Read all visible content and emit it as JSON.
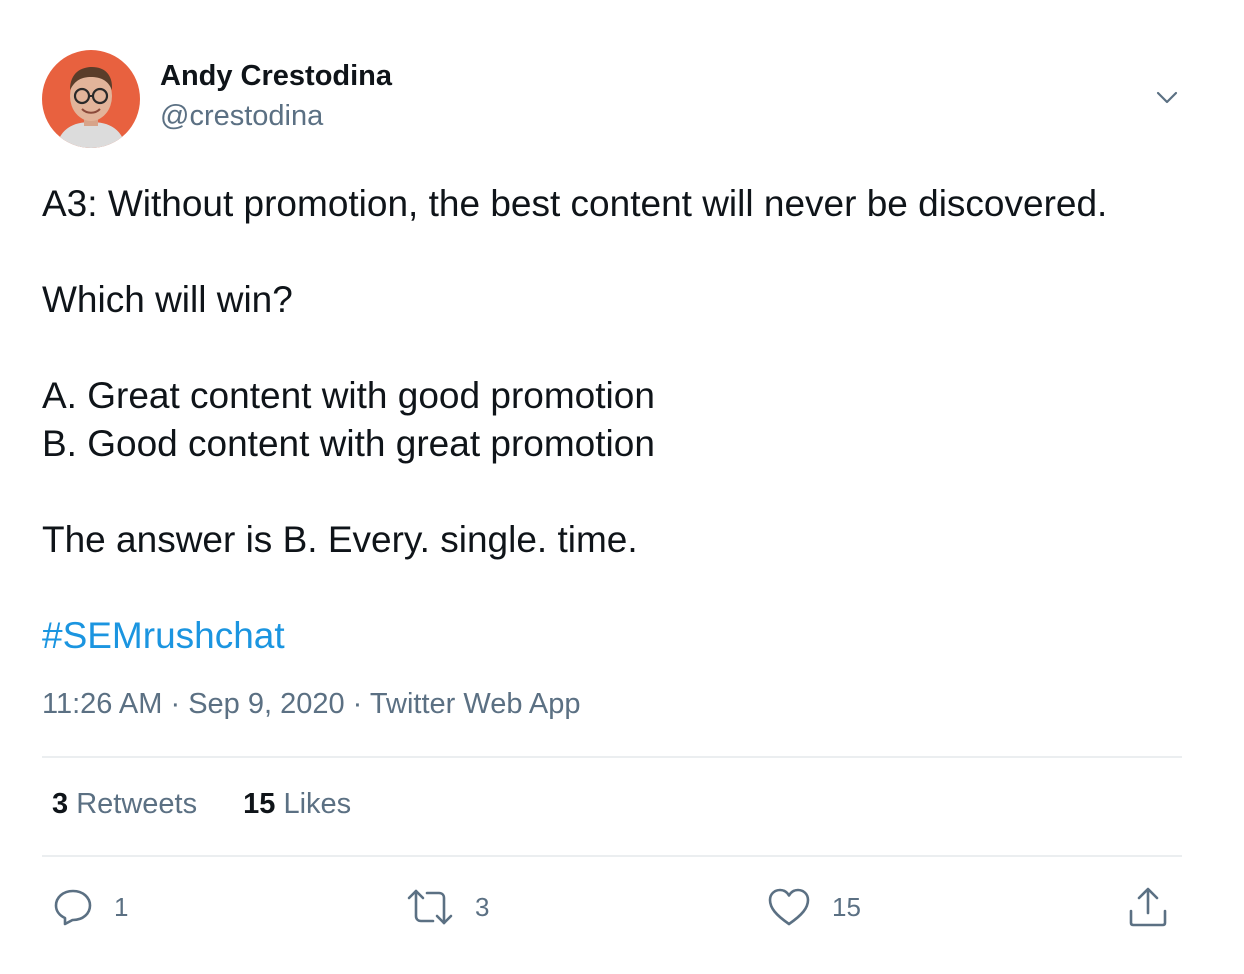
{
  "author": {
    "name": "Andy Crestodina",
    "handle": "@crestodina"
  },
  "tweet": {
    "lines": [
      "A3: Without promotion, the best content will never be discovered.",
      "Which will win?",
      "A. Great content with good promotion",
      "B. Good content with great promotion",
      "The answer is B. Every. single. time."
    ],
    "hashtag": "#SEMrushchat"
  },
  "meta": {
    "time": "11:26 AM",
    "separator": "·",
    "date": "Sep 9, 2020",
    "source": "Twitter Web App"
  },
  "stats": {
    "retweets_count": "3",
    "retweets_label": "Retweets",
    "likes_count": "15",
    "likes_label": "Likes"
  },
  "actions": {
    "reply": {
      "icon": "reply-icon",
      "count": "1"
    },
    "retweet": {
      "icon": "retweet-icon",
      "count": "3"
    },
    "like": {
      "icon": "heart-icon",
      "count": "15"
    },
    "share": {
      "icon": "share-icon"
    }
  },
  "colors": {
    "text": "#0f1419",
    "secondary": "#5b7083",
    "link": "#1b95e0",
    "divider": "#ebeef0",
    "avatar_bg": "#e8613f"
  }
}
